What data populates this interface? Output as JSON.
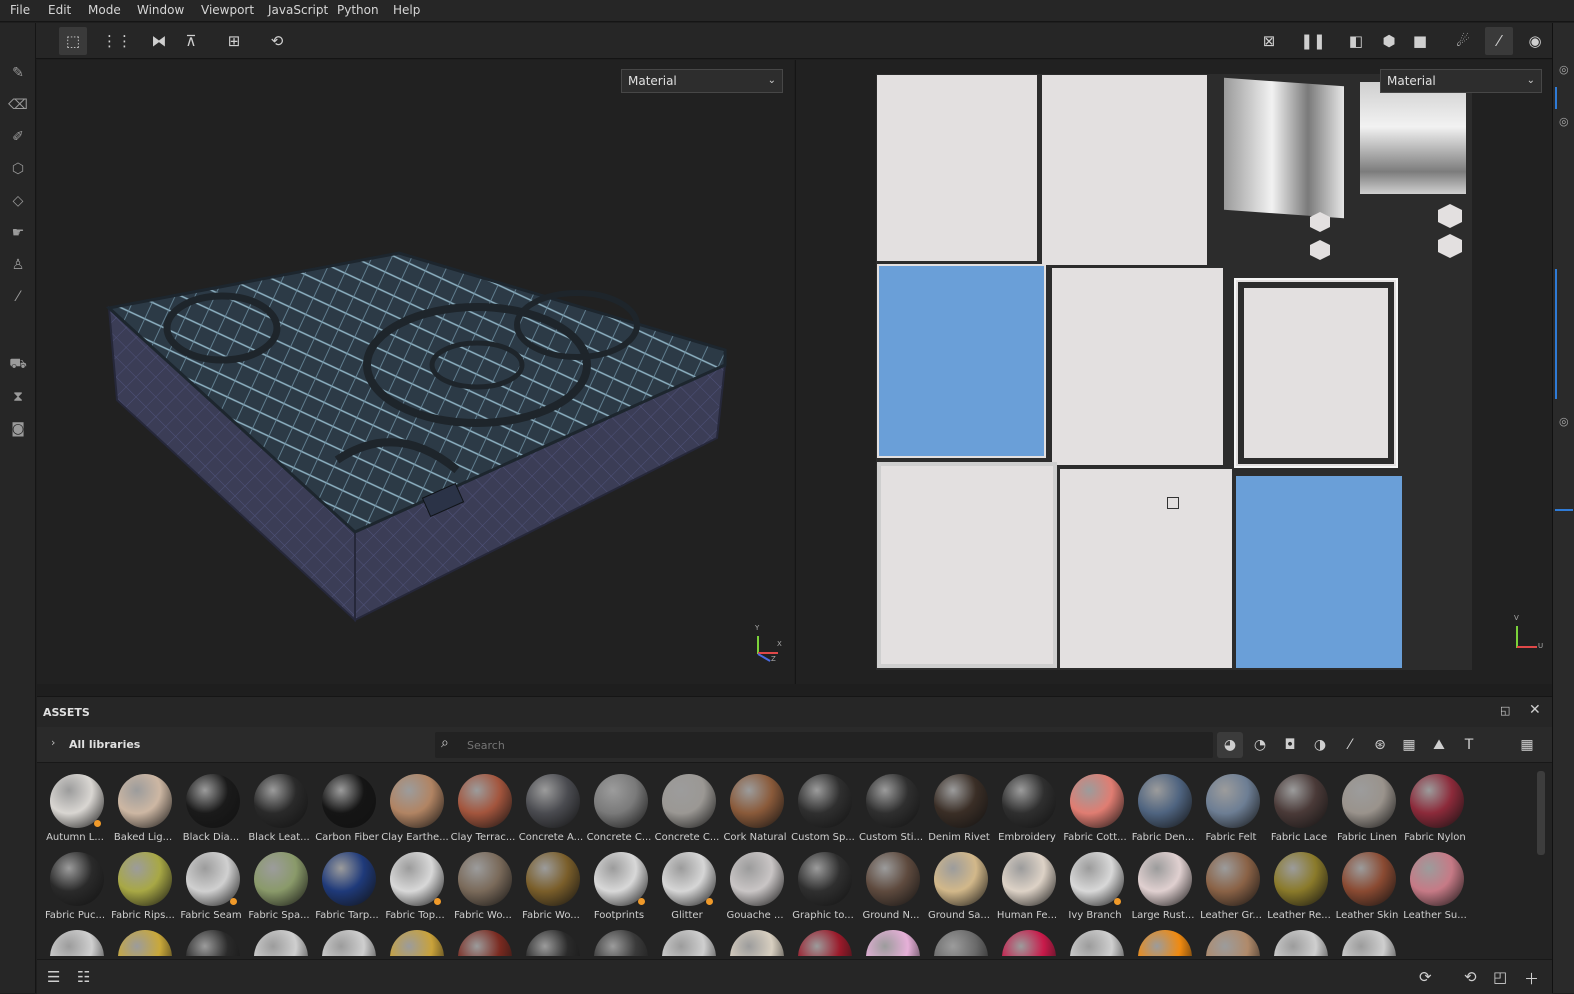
{
  "menu": [
    "File",
    "Edit",
    "Mode",
    "Window",
    "Viewport",
    "JavaScript",
    "Python",
    "Help"
  ],
  "viewport3d": {
    "material_dropdown": "Material"
  },
  "viewport2d": {
    "material_dropdown": "Material"
  },
  "gizmo3d": {
    "y": "Y",
    "x": "X",
    "z": "Z"
  },
  "gizmo2d": {
    "v": "V",
    "u": "U"
  },
  "assets": {
    "title": "ASSETS",
    "library": "All libraries",
    "search_placeholder": "Search",
    "items": [
      {
        "label": "Autumn L...",
        "color": "#d9d6d2",
        "dot": true
      },
      {
        "label": "Baked Lig...",
        "color": "#cdb7a3"
      },
      {
        "label": "Black Dia...",
        "color": "#1a1a1a"
      },
      {
        "label": "Black Leat...",
        "color": "#2a2a2a"
      },
      {
        "label": "Carbon Fiber",
        "color": "#151515"
      },
      {
        "label": "Clay Earthe...",
        "color": "#b18463"
      },
      {
        "label": "Clay Terrac...",
        "color": "#a3553d"
      },
      {
        "label": "Concrete A...",
        "color": "#4a4b50"
      },
      {
        "label": "Concrete C...",
        "color": "#7a7a7a"
      },
      {
        "label": "Concrete C...",
        "color": "#9b9894"
      },
      {
        "label": "Cork Natural",
        "color": "#8a5a3a"
      },
      {
        "label": "Custom Sp...",
        "color": "#2f2f2f"
      },
      {
        "label": "Custom Sti...",
        "color": "#2f2f2f"
      },
      {
        "label": "Denim Rivet",
        "color": "#3a2e26"
      },
      {
        "label": "Embroidery",
        "color": "#2f2f2f"
      },
      {
        "label": "Fabric Cott...",
        "color": "#e07d72"
      },
      {
        "label": "Fabric Den...",
        "color": "#4f6480"
      },
      {
        "label": "Fabric Felt",
        "color": "#6d7e94"
      },
      {
        "label": "Fabric Lace",
        "color": "#4a3a38"
      },
      {
        "label": "Fabric Linen",
        "color": "#9a938c"
      },
      {
        "label": "Fabric Nylon",
        "color": "#8c2a3a"
      },
      {
        "label": "Fabric Puc...",
        "color": "#2a2a2a"
      },
      {
        "label": "Fabric Rips...",
        "color": "#a8a845"
      },
      {
        "label": "Fabric Seam",
        "color": "#d0d0d0",
        "dot": true
      },
      {
        "label": "Fabric Spa...",
        "color": "#8a9a6a"
      },
      {
        "label": "Fabric Tarp...",
        "color": "#1f3a7a"
      },
      {
        "label": "Fabric Top...",
        "color": "#d8d8d8",
        "dot": true
      },
      {
        "label": "Fabric Wo...",
        "color": "#7a6a5a"
      },
      {
        "label": "Fabric Wo...",
        "color": "#7a5e2a"
      },
      {
        "label": "Footprints",
        "color": "#d8d8d8",
        "dot": true
      },
      {
        "label": "Glitter",
        "color": "#d6d6d6",
        "dot": true
      },
      {
        "label": "Gouache ...",
        "color": "#c9c5c5"
      },
      {
        "label": "Graphic to...",
        "color": "#2f2f2f"
      },
      {
        "label": "Ground N...",
        "color": "#5e4a3e"
      },
      {
        "label": "Ground Sa...",
        "color": "#d2b88a"
      },
      {
        "label": "Human Fe...",
        "color": "#ddd2c6"
      },
      {
        "label": "Ivy Branch",
        "color": "#d8d8d8",
        "dot": true
      },
      {
        "label": "Large Rust...",
        "color": "#e0d0d0"
      },
      {
        "label": "Leather Gr...",
        "color": "#8a6246"
      },
      {
        "label": "Leather Re...",
        "color": "#8a7a2a"
      },
      {
        "label": "Leather Skin",
        "color": "#8a4a32"
      },
      {
        "label": "Leather Su...",
        "color": "#c67a86"
      }
    ],
    "third_row": [
      "#cfcfcf",
      "#c9a83a",
      "#2a2a2a",
      "#cfcfcf",
      "#cfcfcf",
      "#c9a23a",
      "#7a2a20",
      "#2a2a2a",
      "#3a3a3a",
      "#cfcfcf",
      "#d8cfc0",
      "#9a1a2a",
      "#e6b0d8",
      "#6a6a6a",
      "#c81a4a",
      "#cfcfcf",
      "#f08a10",
      "#b08a6a",
      "#cfcfcf",
      "#cfcfcf"
    ]
  }
}
